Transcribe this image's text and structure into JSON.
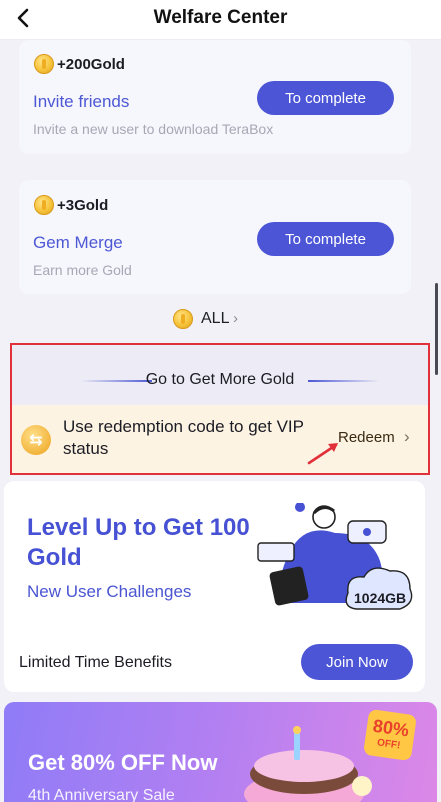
{
  "header": {
    "title": "Welfare Center",
    "back_icon": "chevron-left-icon"
  },
  "tasks": [
    {
      "gold": "+200Gold",
      "name": "Invite friends",
      "button": "To complete",
      "desc": "Invite a new user to download TeraBox"
    },
    {
      "gold": "+3Gold",
      "name": "Gem Merge",
      "button": "To complete",
      "desc": "Earn more Gold"
    }
  ],
  "all_link": {
    "label": "ALL",
    "chevron": "›"
  },
  "more_gold": {
    "title": "Go to Get More Gold",
    "redeem_text": "Use redemption code to get VIP status",
    "redeem_label": "Redeem",
    "redeem_chevron": "›"
  },
  "levelup": {
    "title": "Level Up to Get 100 Gold",
    "subtitle": "New User Challenges",
    "storage_label": "1024GB",
    "limited_label": "Limited Time Benefits",
    "join_button": "Join Now"
  },
  "promo": {
    "title": "Get 80% OFF Now",
    "subtitle": "4th Anniversary Sale",
    "badge_percent": "80%",
    "badge_off": "OFF!"
  },
  "colors": {
    "accent": "#4b55d6",
    "highlight": "#e2303a",
    "redeem_bg": "#fdf3e3"
  }
}
